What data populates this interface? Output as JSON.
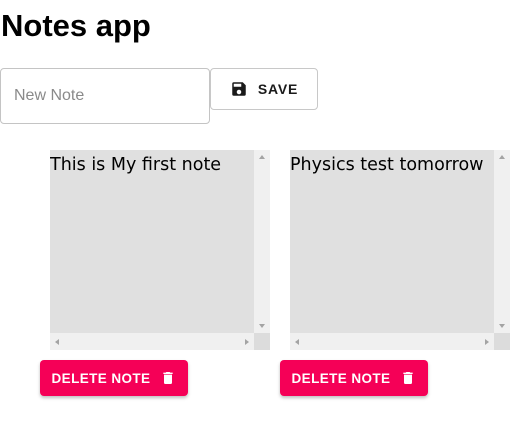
{
  "app": {
    "title": "Notes app"
  },
  "new_note": {
    "placeholder": "New Note",
    "value": ""
  },
  "toolbar": {
    "save_label": "SAVE",
    "save_icon": "floppy-disk-icon"
  },
  "notes": [
    {
      "text": "This is My first note",
      "delete_label": "DELETE NOTE",
      "delete_icon": "trash-icon"
    },
    {
      "text": "Physics test tomorrow",
      "delete_label": "DELETE NOTE",
      "delete_icon": "trash-icon"
    }
  ],
  "colors": {
    "delete_button": "#f50057",
    "note_background": "#e0e0e0",
    "input_border": "#c4c4c4"
  }
}
